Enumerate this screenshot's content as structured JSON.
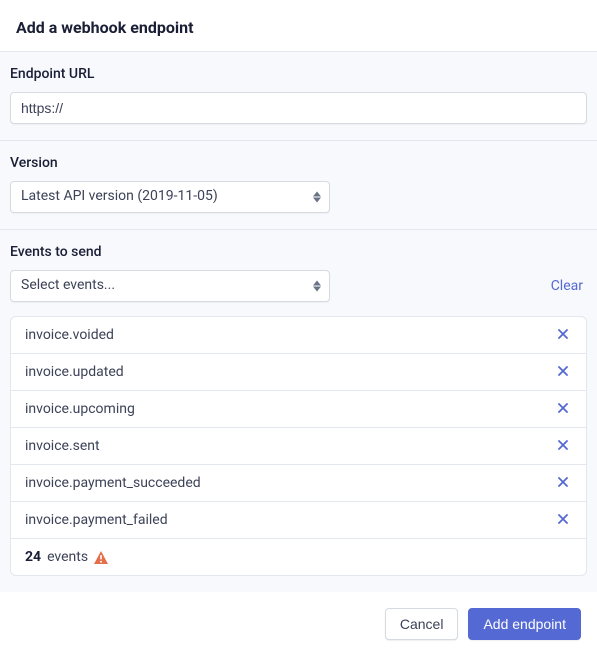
{
  "header": {
    "title": "Add a webhook endpoint"
  },
  "endpoint": {
    "label": "Endpoint URL",
    "value": "https://"
  },
  "version": {
    "label": "Version",
    "selected": "Latest API version (2019-11-05)"
  },
  "events": {
    "label": "Events to send",
    "placeholder": "Select events...",
    "clear": "Clear",
    "items": [
      {
        "name": "invoice.voided"
      },
      {
        "name": "invoice.updated"
      },
      {
        "name": "invoice.upcoming"
      },
      {
        "name": "invoice.sent"
      },
      {
        "name": "invoice.payment_succeeded"
      },
      {
        "name": "invoice.payment_failed"
      }
    ],
    "count": "24",
    "count_label": "events"
  },
  "actions": {
    "cancel": "Cancel",
    "submit": "Add endpoint"
  }
}
